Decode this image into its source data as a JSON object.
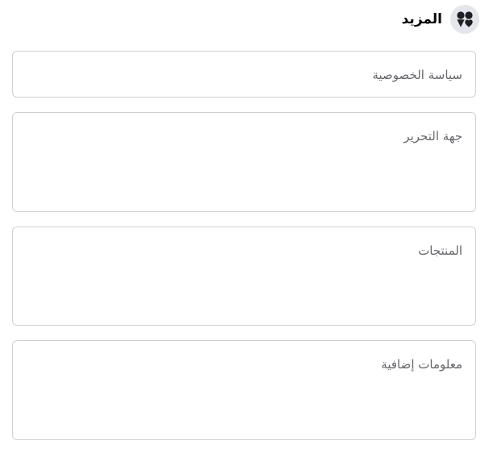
{
  "header": {
    "title": "المزيد",
    "icon": "shapes-icon"
  },
  "sections": [
    {
      "label": "سياسة الخصوصية"
    },
    {
      "label": "جهة التحرير"
    },
    {
      "label": "المنتجات"
    },
    {
      "label": "معلومات إضافية"
    }
  ],
  "colors": {
    "border": "#ced0d4",
    "label": "#65676b",
    "title": "#050505",
    "icon_bg": "#e4e6eb"
  }
}
